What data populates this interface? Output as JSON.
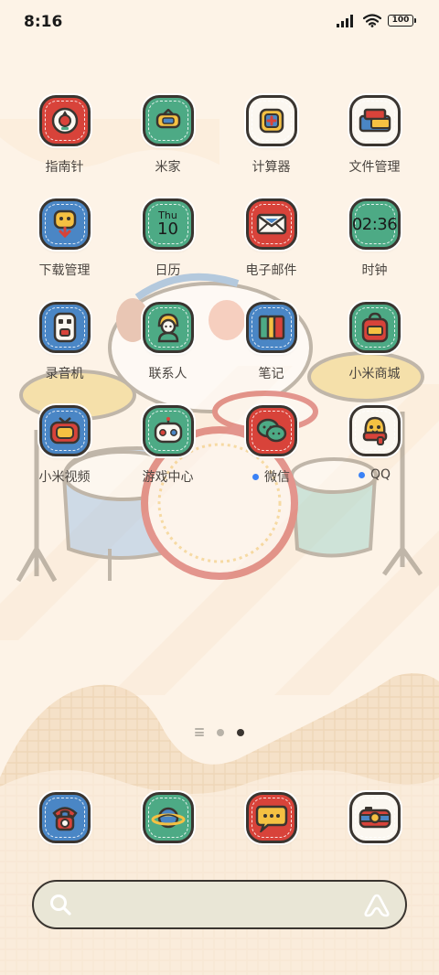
{
  "status_bar": {
    "time": "8:16",
    "battery": "100"
  },
  "apps": [
    {
      "label": "指南针",
      "icon": "compass-icon",
      "color": "#d8433a",
      "badge": false
    },
    {
      "label": "米家",
      "icon": "mijia-icon",
      "color": "#4daa85",
      "badge": false
    },
    {
      "label": "计算器",
      "icon": "calculator-icon",
      "color": "#fbf7f0",
      "badge": false
    },
    {
      "label": "文件管理",
      "icon": "folder-icon",
      "color": "#fbf7f0",
      "badge": false
    },
    {
      "label": "下载管理",
      "icon": "download-icon",
      "color": "#4a86c5",
      "badge": false
    },
    {
      "label": "日历",
      "icon": "calendar-icon",
      "color": "#4daa85",
      "badge": false,
      "calendar_weekday": "Thu",
      "calendar_day": "10"
    },
    {
      "label": "电子邮件",
      "icon": "mail-icon",
      "color": "#d8433a",
      "badge": false
    },
    {
      "label": "时钟",
      "icon": "clock-icon",
      "color": "#4daa85",
      "badge": false,
      "clock_time": "02:36"
    },
    {
      "label": "录音机",
      "icon": "recorder-icon",
      "color": "#4a86c5",
      "badge": false
    },
    {
      "label": "联系人",
      "icon": "contacts-icon",
      "color": "#4daa85",
      "badge": false
    },
    {
      "label": "笔记",
      "icon": "notes-icon",
      "color": "#4a86c5",
      "badge": false
    },
    {
      "label": "小米商城",
      "icon": "shop-bag-icon",
      "color": "#4daa85",
      "badge": false
    },
    {
      "label": "小米视频",
      "icon": "tv-icon",
      "color": "#4a86c5",
      "badge": false
    },
    {
      "label": "游戏中心",
      "icon": "game-robot-icon",
      "color": "#4daa85",
      "badge": false
    },
    {
      "label": "微信",
      "icon": "wechat-icon",
      "color": "#d8433a",
      "badge": true
    },
    {
      "label": "QQ",
      "icon": "qq-penguin-icon",
      "color": "#fbf7f0",
      "badge": true
    }
  ],
  "dock": [
    {
      "icon": "phone-icon",
      "color": "#4a86c5"
    },
    {
      "icon": "planet-browser-icon",
      "color": "#4daa85"
    },
    {
      "icon": "message-bubble-icon",
      "color": "#d8433a"
    },
    {
      "icon": "camera-icon",
      "color": "#fbf7f0"
    }
  ],
  "page_indicator": {
    "pages": 2,
    "active": 2
  },
  "search_bar": {
    "icon": "search-icon",
    "assistant_icon": "assistant-icon"
  }
}
